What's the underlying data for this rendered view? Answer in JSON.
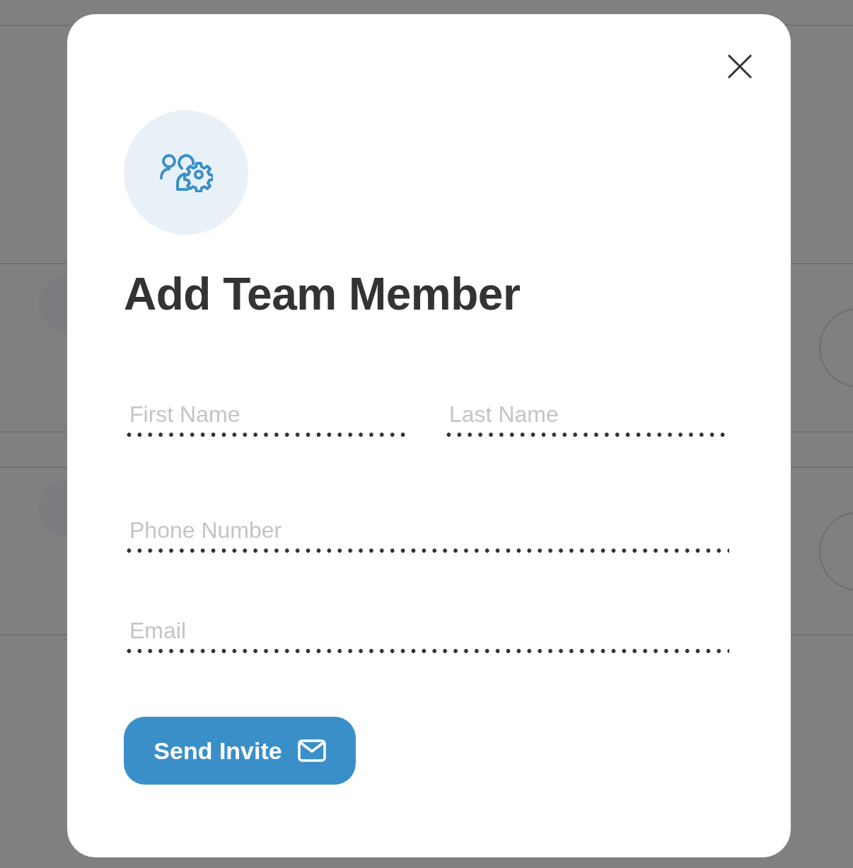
{
  "dialog": {
    "title": "Add Team Member",
    "fields": [
      {
        "placeholder": "First Name"
      },
      {
        "placeholder": "Last Name"
      },
      {
        "placeholder": "Phone Number"
      },
      {
        "placeholder": "Email"
      }
    ],
    "submit": {
      "label": "Send Invite"
    }
  }
}
